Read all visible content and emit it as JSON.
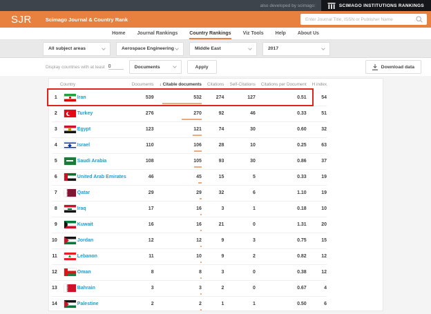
{
  "topbar": {
    "developed_by": "also developed by scimago:",
    "sir_label": "SCIMAGO INSTITUTIONS RANKINGS"
  },
  "header": {
    "logo": "SJR",
    "title": "Scimago Journal & Country Rank",
    "search_placeholder": "Enter Journal Title, ISSN or Publisher Name"
  },
  "nav": {
    "items": [
      {
        "label": "Home",
        "active": false
      },
      {
        "label": "Journal Rankings",
        "active": false
      },
      {
        "label": "Country Rankings",
        "active": true
      },
      {
        "label": "Viz Tools",
        "active": false
      },
      {
        "label": "Help",
        "active": false
      },
      {
        "label": "About Us",
        "active": false
      }
    ]
  },
  "filters": {
    "subject_area": "All subject areas",
    "subject_category": "Aerospace Engineering",
    "region": "Middle East",
    "year": "2017"
  },
  "tools": {
    "display_label": "Display countries with at least",
    "min_value": "0",
    "metric": "Documents",
    "apply_label": "Apply",
    "download_label": "Download data"
  },
  "table": {
    "columns": [
      "Country",
      "Documents",
      "Citable documents",
      "Citations",
      "Self-Citations",
      "Citations per Document",
      "H index"
    ],
    "sorted_column": "Citable documents",
    "sort_direction": "desc",
    "rows": [
      {
        "rank": "1",
        "country": "Iran",
        "documents": "539",
        "citable": "532",
        "citations": "274",
        "self_citations": "127",
        "citations_per_doc": "0.51",
        "h_index": "54",
        "highlighted": true
      },
      {
        "rank": "2",
        "country": "Turkey",
        "documents": "276",
        "citable": "270",
        "citations": "92",
        "self_citations": "46",
        "citations_per_doc": "0.33",
        "h_index": "51",
        "highlighted": false
      },
      {
        "rank": "3",
        "country": "Egypt",
        "documents": "123",
        "citable": "121",
        "citations": "74",
        "self_citations": "30",
        "citations_per_doc": "0.60",
        "h_index": "32",
        "highlighted": false
      },
      {
        "rank": "4",
        "country": "Israel",
        "documents": "110",
        "citable": "106",
        "citations": "28",
        "self_citations": "10",
        "citations_per_doc": "0.25",
        "h_index": "63",
        "highlighted": false
      },
      {
        "rank": "5",
        "country": "Saudi Arabia",
        "documents": "108",
        "citable": "105",
        "citations": "93",
        "self_citations": "30",
        "citations_per_doc": "0.86",
        "h_index": "37",
        "highlighted": false
      },
      {
        "rank": "6",
        "country": "United Arab Emirates",
        "documents": "46",
        "citable": "45",
        "citations": "15",
        "self_citations": "5",
        "citations_per_doc": "0.33",
        "h_index": "19",
        "highlighted": false
      },
      {
        "rank": "7",
        "country": "Qatar",
        "documents": "29",
        "citable": "29",
        "citations": "32",
        "self_citations": "6",
        "citations_per_doc": "1.10",
        "h_index": "19",
        "highlighted": false
      },
      {
        "rank": "8",
        "country": "Iraq",
        "documents": "17",
        "citable": "16",
        "citations": "3",
        "self_citations": "1",
        "citations_per_doc": "0.18",
        "h_index": "10",
        "highlighted": false
      },
      {
        "rank": "9",
        "country": "Kuwait",
        "documents": "16",
        "citable": "16",
        "citations": "21",
        "self_citations": "0",
        "citations_per_doc": "1.31",
        "h_index": "20",
        "highlighted": false
      },
      {
        "rank": "10",
        "country": "Jordan",
        "documents": "12",
        "citable": "12",
        "citations": "9",
        "self_citations": "3",
        "citations_per_doc": "0.75",
        "h_index": "15",
        "highlighted": false
      },
      {
        "rank": "11",
        "country": "Lebanon",
        "documents": "11",
        "citable": "10",
        "citations": "9",
        "self_citations": "2",
        "citations_per_doc": "0.82",
        "h_index": "12",
        "highlighted": false
      },
      {
        "rank": "12",
        "country": "Oman",
        "documents": "8",
        "citable": "8",
        "citations": "3",
        "self_citations": "0",
        "citations_per_doc": "0.38",
        "h_index": "12",
        "highlighted": false
      },
      {
        "rank": "13",
        "country": "Bahrain",
        "documents": "3",
        "citable": "3",
        "citations": "2",
        "self_citations": "0",
        "citations_per_doc": "0.67",
        "h_index": "4",
        "highlighted": false
      },
      {
        "rank": "14",
        "country": "Palestine",
        "documents": "2",
        "citable": "2",
        "citations": "1",
        "self_citations": "1",
        "citations_per_doc": "0.50",
        "h_index": "6",
        "highlighted": false
      }
    ]
  },
  "colors": {
    "accent_orange": "#e8813f",
    "link_blue": "#199dd9",
    "highlight_border": "#dd241a",
    "citable_bar": "#efa87a",
    "topbar_dark": "#3e444b"
  }
}
